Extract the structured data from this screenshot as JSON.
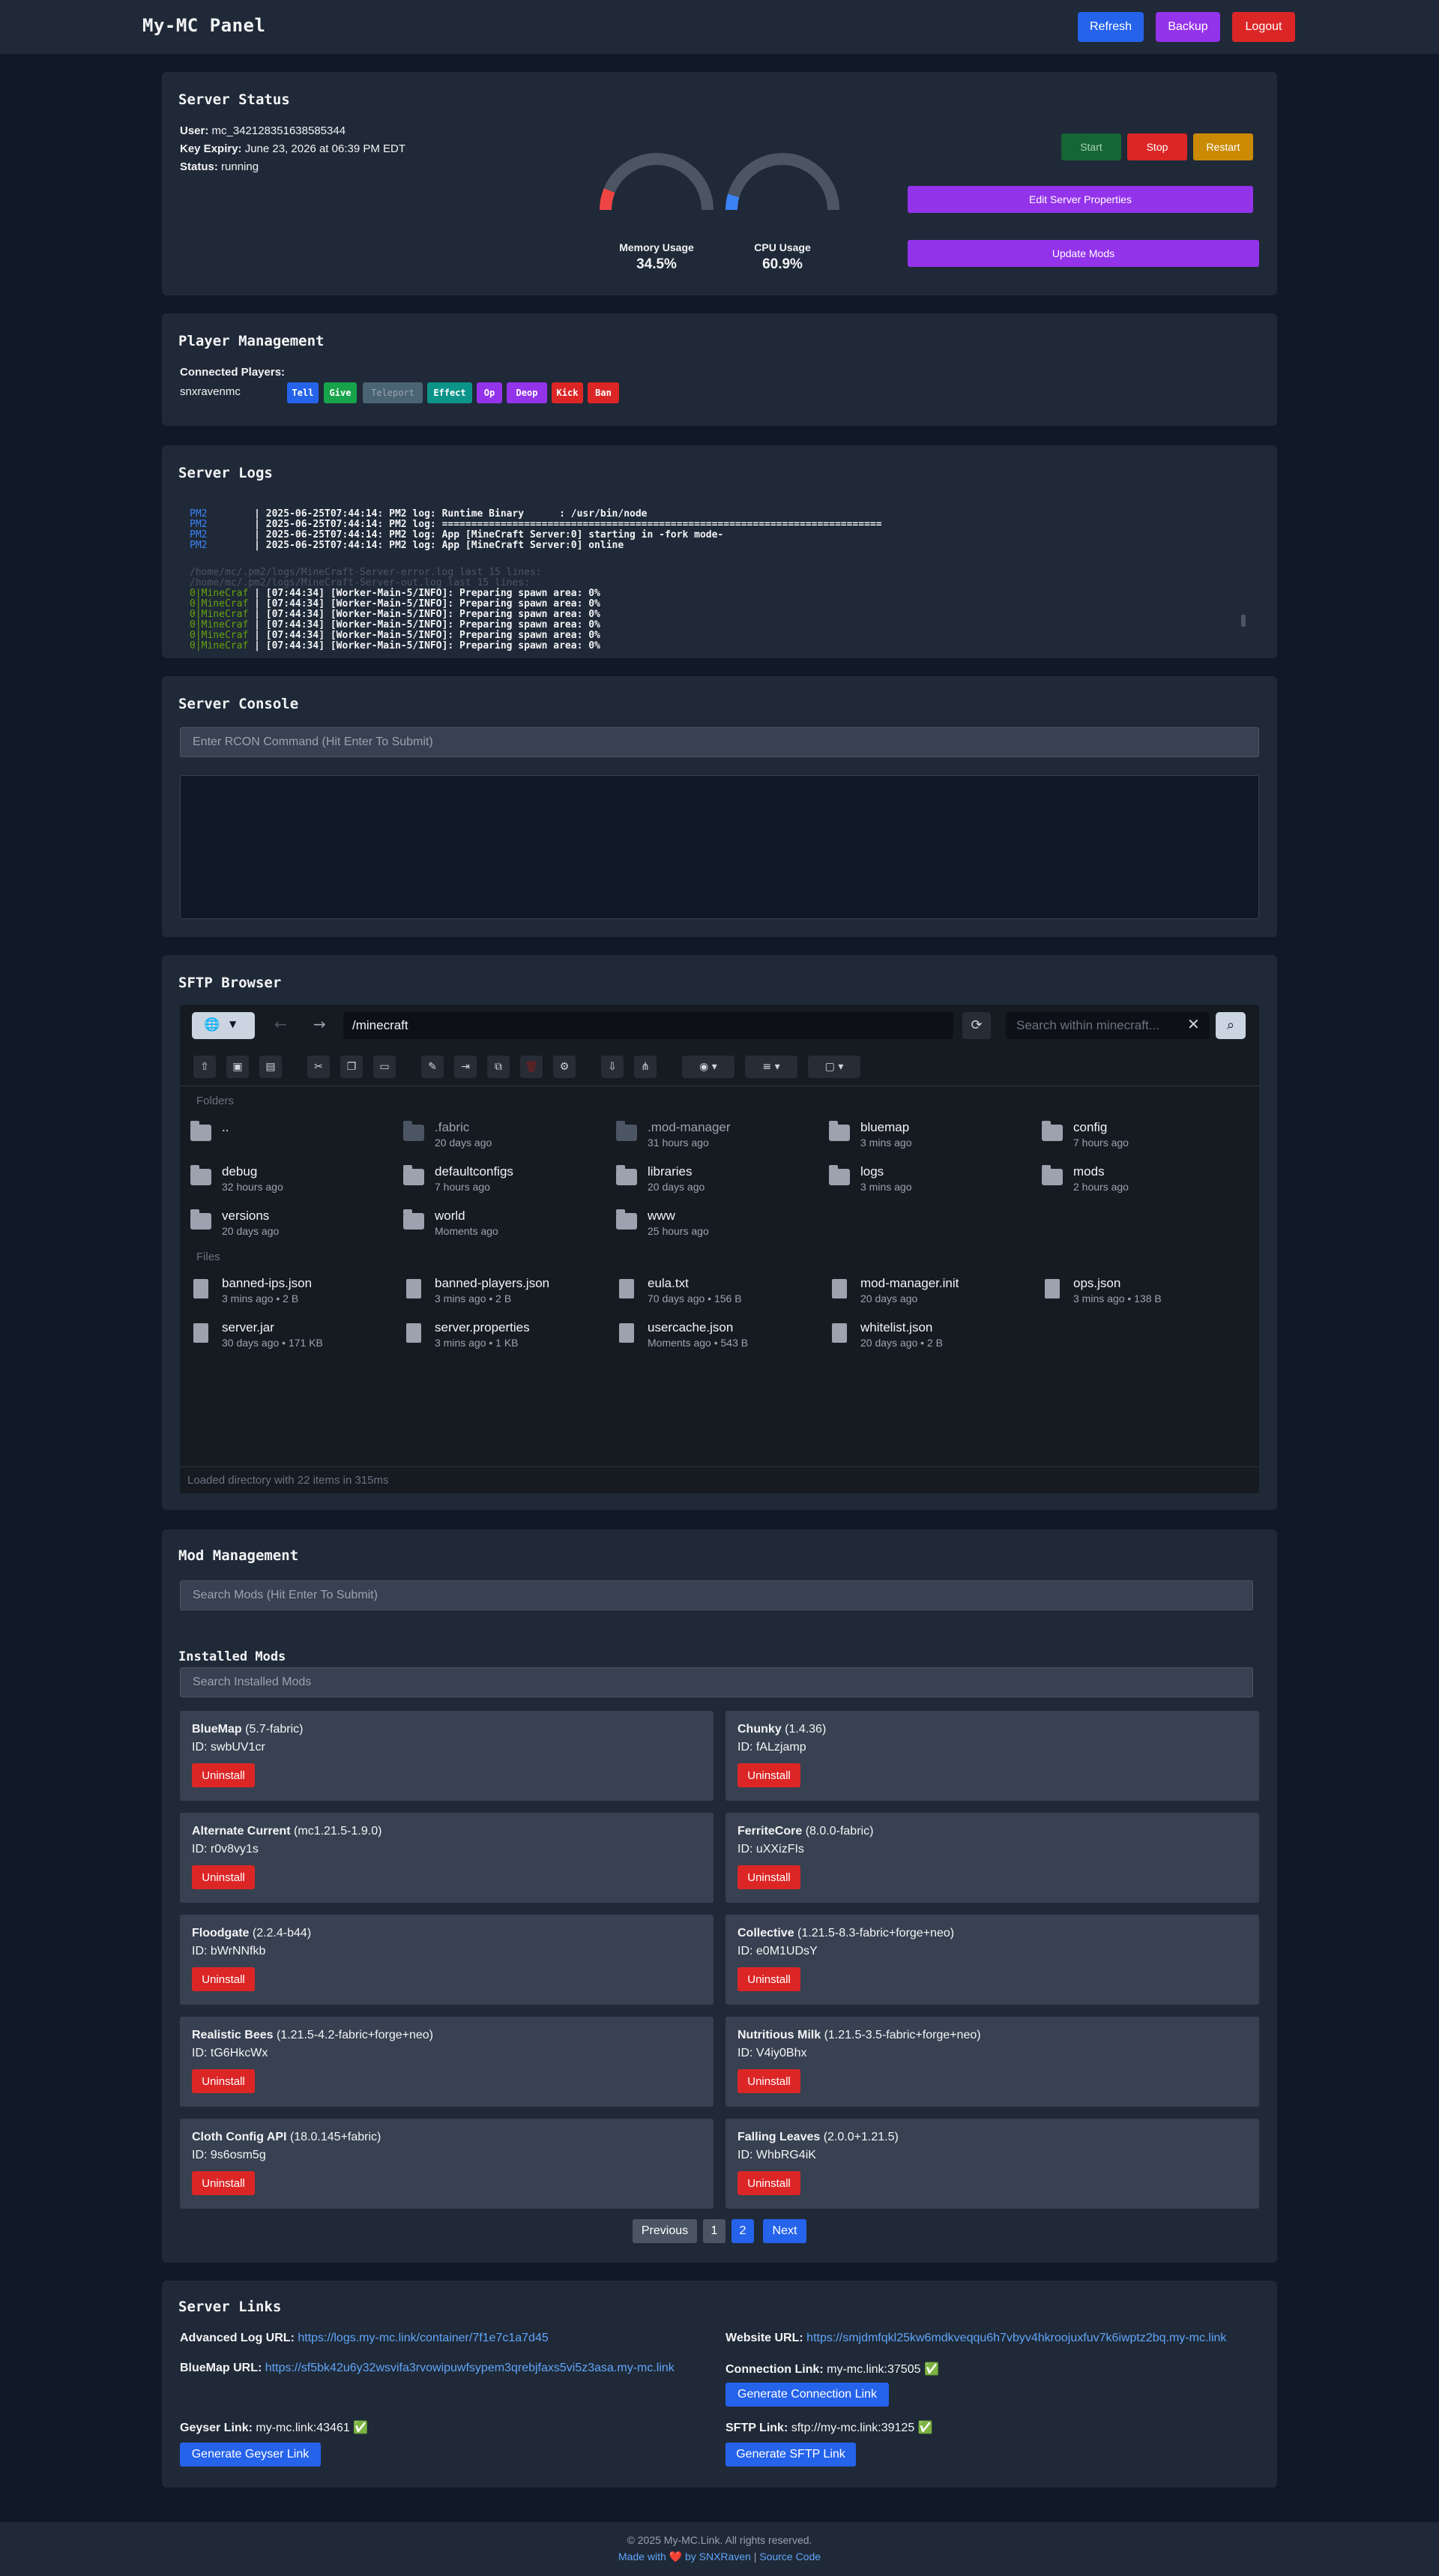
{
  "header": {
    "brand": "My-MC Panel",
    "refresh": "Refresh",
    "backup": "Backup",
    "logout": "Logout"
  },
  "status": {
    "title": "Server Status",
    "user_label": "User:",
    "user_value": "mc_342128351638585344",
    "expiry_label": "Key Expiry:",
    "expiry_value": "June 23, 2026 at 06:39 PM EDT",
    "status_label": "Status:",
    "status_value": "running",
    "memory_label": "Memory Usage",
    "memory_value": "34.5%",
    "memory_fraction": 0.345,
    "cpu_label": "CPU Usage",
    "cpu_value": "60.9%",
    "cpu_fraction": 0.609,
    "start": "Start",
    "stop": "Stop",
    "restart": "Restart",
    "edit_props": "Edit Server Properties",
    "update_mods": "Update Mods"
  },
  "players": {
    "title": "Player Management",
    "connected_label": "Connected Players:",
    "player_name": "snxravenmc",
    "actions": [
      "Tell",
      "Give",
      "Teleport",
      "Effect",
      "Op",
      "Deop",
      "Kick",
      "Ban"
    ]
  },
  "logs": {
    "title": "Server Logs",
    "lines": [
      "2025-06-25T07:44:14: PM2 log: Runtime Binary      : /usr/bin/node",
      "2025-06-25T07:44:14: PM2 log: ===========================================================================",
      "2025-06-25T07:44:14: PM2 log: App [MineCraft Server:0] starting in -fork mode-",
      "2025-06-25T07:44:14: PM2 log: App [MineCraft Server:0] online"
    ],
    "pm2_prefix": "PM2",
    "err_path": "/home/mc/.pm2/logs/MineCraft-Server-error.log last 15 lines:",
    "out_path": "/home/mc/.pm2/logs/MineCraft-Server-out.log last 15 lines:",
    "mc_prefix": "0|MineCraf",
    "mc_line": "[07:44:34] [Worker-Main-5/INFO]: Preparing spawn area: 0%"
  },
  "console": {
    "title": "Server Console",
    "placeholder": "Enter RCON Command (Hit Enter To Submit)"
  },
  "sftp": {
    "title": "SFTP Browser",
    "path": "/minecraft",
    "search_placeholder": "Search within minecraft...",
    "folders_label": "Folders",
    "files_label": "Files",
    "folders": [
      {
        "name": "..",
        "meta": "",
        "dim": false
      },
      {
        "name": ".fabric",
        "meta": "20 days ago",
        "dim": true
      },
      {
        "name": ".mod-manager",
        "meta": "31 hours ago",
        "dim": true
      },
      {
        "name": "bluemap",
        "meta": "3 mins ago",
        "dim": false
      },
      {
        "name": "config",
        "meta": "7 hours ago",
        "dim": false
      },
      {
        "name": "debug",
        "meta": "32 hours ago",
        "dim": false
      },
      {
        "name": "defaultconfigs",
        "meta": "7 hours ago",
        "dim": false
      },
      {
        "name": "libraries",
        "meta": "20 days ago",
        "dim": false
      },
      {
        "name": "logs",
        "meta": "3 mins ago",
        "dim": false
      },
      {
        "name": "mods",
        "meta": "2 hours ago",
        "dim": false
      },
      {
        "name": "versions",
        "meta": "20 days ago",
        "dim": false
      },
      {
        "name": "world",
        "meta": "Moments ago",
        "dim": false
      },
      {
        "name": "www",
        "meta": "25 hours ago",
        "dim": false
      }
    ],
    "files": [
      {
        "name": "banned-ips.json",
        "meta": "3 mins ago • 2 B"
      },
      {
        "name": "banned-players.json",
        "meta": "3 mins ago • 2 B"
      },
      {
        "name": "eula.txt",
        "meta": "70 days ago • 156 B"
      },
      {
        "name": "mod-manager.init",
        "meta": "20 days ago"
      },
      {
        "name": "ops.json",
        "meta": "3 mins ago • 138 B"
      },
      {
        "name": "server.jar",
        "meta": "30 days ago • 171 KB"
      },
      {
        "name": "server.properties",
        "meta": "3 mins ago • 1 KB"
      },
      {
        "name": "usercache.json",
        "meta": "Moments ago • 543 B"
      },
      {
        "name": "whitelist.json",
        "meta": "20 days ago • 2 B"
      }
    ],
    "status": "Loaded directory with 22 items in 315ms"
  },
  "mods": {
    "title": "Mod Management",
    "search_placeholder": "Search Mods (Hit Enter To Submit)",
    "installed_title": "Installed Mods",
    "installed_placeholder": "Search Installed Mods",
    "uninstall": "Uninstall",
    "id_label": "ID:",
    "items": [
      {
        "name": "BlueMap",
        "version": "(5.7-fabric)",
        "id": "swbUV1cr"
      },
      {
        "name": "Chunky",
        "version": "(1.4.36)",
        "id": "fALzjamp"
      },
      {
        "name": "Alternate Current",
        "version": "(mc1.21.5-1.9.0)",
        "id": "r0v8vy1s"
      },
      {
        "name": "FerriteCore",
        "version": "(8.0.0-fabric)",
        "id": "uXXizFIs"
      },
      {
        "name": "Floodgate",
        "version": "(2.2.4-b44)",
        "id": "bWrNNfkb"
      },
      {
        "name": "Collective",
        "version": "(1.21.5-8.3-fabric+forge+neo)",
        "id": "e0M1UDsY"
      },
      {
        "name": "Realistic Bees",
        "version": "(1.21.5-4.2-fabric+forge+neo)",
        "id": "tG6HkcWx"
      },
      {
        "name": "Nutritious Milk",
        "version": "(1.21.5-3.5-fabric+forge+neo)",
        "id": "V4iy0Bhx"
      },
      {
        "name": "Cloth Config API",
        "version": "(18.0.145+fabric)",
        "id": "9s6osm5g"
      },
      {
        "name": "Falling Leaves",
        "version": "(2.0.0+1.21.5)",
        "id": "WhbRG4iK"
      }
    ],
    "pagination": {
      "previous": "Previous",
      "p1": "1",
      "p2": "2",
      "next": "Next"
    }
  },
  "links": {
    "title": "Server Links",
    "adv_label": "Advanced Log URL:",
    "adv_value": "https://logs.my-mc.link/container/7f1e7c1a7d45",
    "website_label": "Website URL:",
    "website_value": "https://smjdmfqkl25kw6mdkveqqu6h7vbyv4hkroojuxfuv7k6iwptz2bq.my-mc.link",
    "bluemap_label": "BlueMap URL:",
    "bluemap_value": "https://sf5bk42u6y32wsvifa3rvowipuwfsypem3qrebjfaxs5vi5z3asa.my-mc.link",
    "conn_label": "Connection Link:",
    "conn_value": "my-mc.link:37505",
    "gen_conn": "Generate Connection Link",
    "geyser_label": "Geyser Link:",
    "geyser_value": "my-mc.link:43461",
    "gen_geyser": "Generate Geyser Link",
    "sftp_label": "SFTP Link:",
    "sftp_value": "sftp://my-mc.link:39125",
    "gen_sftp": "Generate SFTP Link",
    "check": "✅"
  },
  "footer": {
    "copyright": "© 2025 My-MC.Link. All rights reserved.",
    "made_with": "Made with",
    "heart": "❤️",
    "by": "by SNXRaven",
    "sep": "|",
    "source": "Source Code"
  },
  "colors": {
    "bg": "#111827",
    "card": "#1f2937",
    "blue": "#2563eb",
    "purple": "#9333ea",
    "red": "#dc2626"
  }
}
